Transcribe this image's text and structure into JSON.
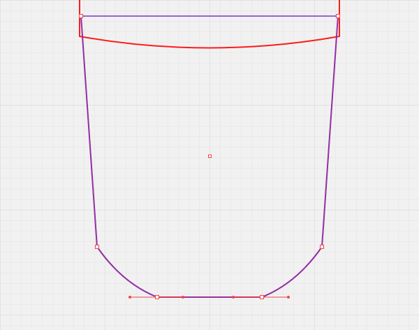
{
  "canvas": {
    "tool": "vector-path-editor",
    "background": "#f1f1f1",
    "grid": {
      "minor_color": "#e4e4e4",
      "major_color": "#d2d2d2",
      "visible": true
    }
  },
  "colors": {
    "outline_red": "#ff1a1a",
    "path_purple": "#7a35c9",
    "handle_red": "#f04646"
  },
  "icons": {
    "anchor_point": "square-anchor-icon",
    "control_handle": "round-handle-icon",
    "center_marker": "center-point-icon"
  }
}
